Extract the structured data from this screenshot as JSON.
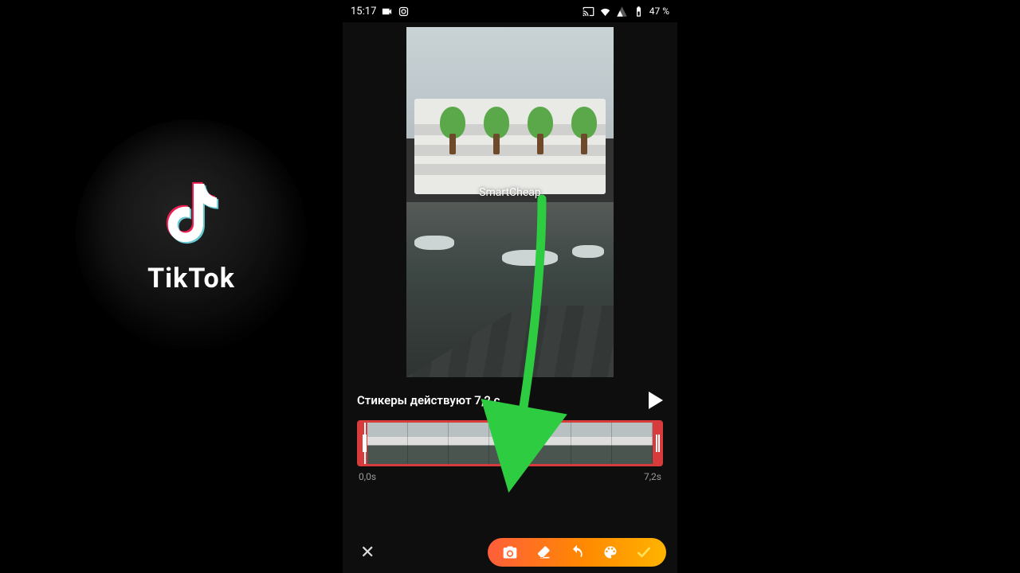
{
  "statusbar": {
    "time": "15:17",
    "battery": "47 %"
  },
  "preview": {
    "watermark": "SmartCheap"
  },
  "duration": {
    "label": "Стикеры действуют 7,2 с"
  },
  "timeline": {
    "start": "0,0s",
    "end": "7,2s",
    "frame_count": 7
  },
  "toolbar": {
    "icons": [
      "camera-icon",
      "eraser-icon",
      "undo-icon",
      "palette-icon",
      "confirm-icon"
    ]
  },
  "tiktok": {
    "label": "TikTok"
  },
  "colors": {
    "timeline_border": "#d73b3b",
    "pill_gradient_start": "#ff5e3a",
    "pill_gradient_end": "#ffb300",
    "arrow": "#2ecc40"
  }
}
